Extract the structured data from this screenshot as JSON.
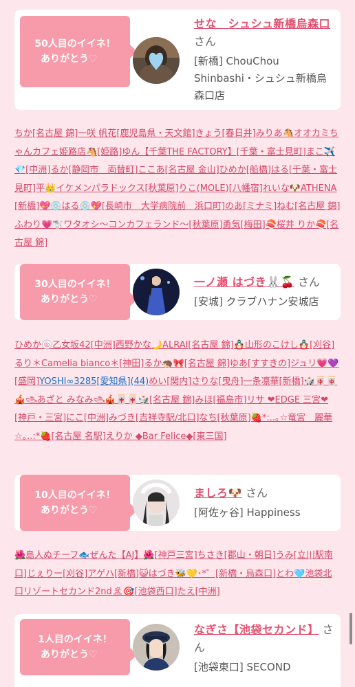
{
  "colors": {
    "background": "#fde6ec",
    "badge": "#f79aa9",
    "name": "#e4506f",
    "liker_link": "#d64868",
    "special_link": "#1a6fc4"
  },
  "sections": [
    {
      "badge_line1": "50人目のイイネ！",
      "badge_line2": "ありがとう",
      "heart": "♡",
      "name": "せな　シュシュ新橋烏森口",
      "san": "さん",
      "shop": "[新橋] ChouChou Shinbashi・シュシュ新橋烏森口店",
      "likers": "ちか[名古屋 錦]一咲 帆花[鹿児島県・天文館]きょう[春日井]みりあ🐴オオカミちゃんカフェ姫路店🐴[姫路]ゆん【千葉THE FACTORY】[千葉・富士見町]まこ✈️💎[中洲]るか[静岡市　両替町]ここあ[名古屋 金山]ひめか[船橋]はる[千葉・富士見町]平👑イケメンパラドックス[秋葉原]りこ(MOLE)[八幡宿]れいな🐶ATHENA[新橋]💖💿はる💿💖[長崎市　大学病院前　浜口町]のあ[ミナミ]ねむ[名古屋 錦]ふわり💗🐩ワタオシ〜コンカフェランド〜[秋葉原]勇気[梅田]🍣桜井 りか🍣[名古屋 錦]"
    },
    {
      "badge_line1": "30人目のイイネ！",
      "badge_line2": "ありがとう",
      "heart": "♡",
      "name": "一ノ瀬 はづき🐰🍒",
      "san": "さん",
      "shop": "[安城] クラブハナン安城店",
      "likers_a": "ひめか🍥乙女坂42[中洲]西野かな🌙ALRAI[名古屋 錦]🪆山形のこけし🪆[刈谷]るり＊Camelia bianco＊[神田]るか🦔🎀[名古屋 錦]ゆあ[すすきの]ジュリ💗💜[盛岡]",
      "likers_b": "YOSHI∞3285[愛知県](44)",
      "likers_c": "めい[関内]さりな[曳舟]一条凛華[新橋]🎲🀄🀄🎪🛥あざと みなみ🛥🎪🀄🀄🎲[名古屋 錦]みほ[福島市]リサ ❤EDGE 三宮❤[神戸・三宮]にこ[中洲]みづき[吉祥寺駅/北口]なち[秋葉原]🍓*:..｡☆竜宮　麗華☆｡..:*🍓[名古屋 名駅]えりか ◆Bar Felice◆[東三国]"
    },
    {
      "badge_line1": "10人目のイイネ！",
      "badge_line2": "ありがとう",
      "heart": "♡",
      "name": "ましろ🐶",
      "san": "さん",
      "shop": "[阿佐ヶ谷] Happiness",
      "likers": "🌺島人ぬチーフ🐟ぜんた【AJ】🌺[神戸三宮]ちさき[郡山・朝日]うみ[立川駅南口]じぇりー[刈谷]アゲハ[新橋]😺はづき🐝💛･*゜[新橋・烏森口]とわ🩵池袋北口リゾートセカンド2nd🏝🎯[池袋西口]たえ[中洲]"
    },
    {
      "badge_line1": "1人目のイイネ！",
      "badge_line2": "ありがとう",
      "heart": "♡",
      "name": "なぎさ【池袋セカンド】",
      "san": "さん",
      "shop": "[池袋東口] SECOND"
    }
  ]
}
